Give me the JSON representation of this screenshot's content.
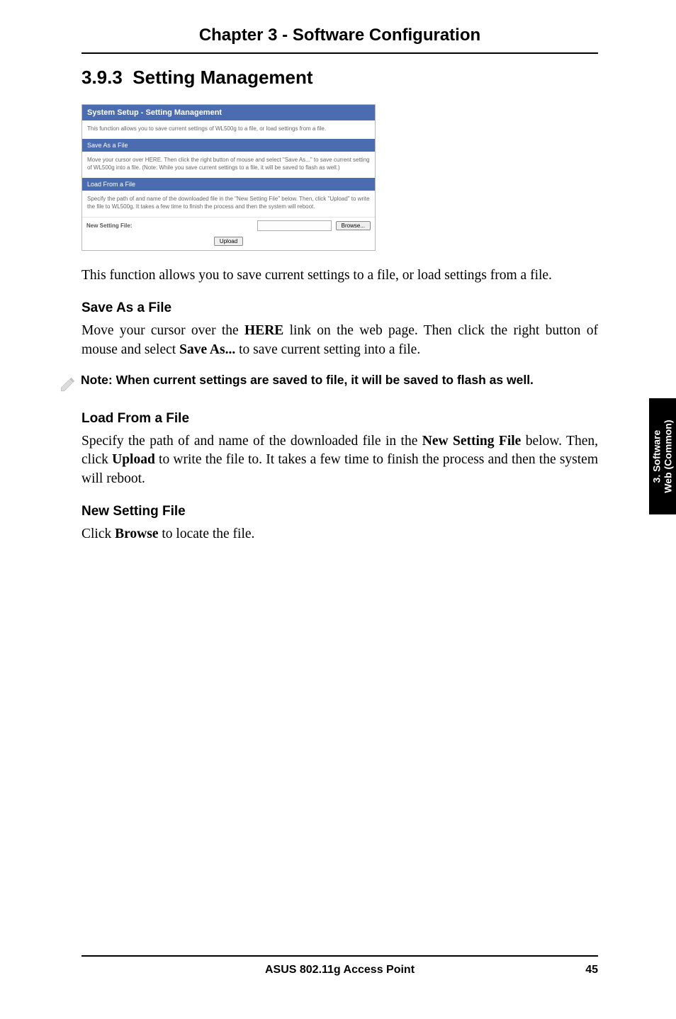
{
  "chapter": {
    "title": "Chapter 3 - Software Configuration"
  },
  "section": {
    "number": "3.9.3",
    "title": "Setting Management"
  },
  "screenshot": {
    "title": "System Setup - Setting Management",
    "intro": "This function allows you to save current settings of WL500g to a file, or load settings from a file.",
    "save_hdr": "Save As a File",
    "save_desc": "Move your cursor over HERE. Then click the right button of mouse and select \"Save As...\" to save current setting of WL500g into a file. (Note: While you save current settings to a file, it will be saved to flash as well.)",
    "load_hdr": "Load From a File",
    "load_desc": "Specify the path of and name of the downloaded file in the \"New Setting File\" below. Then, click \"Upload\" to write the file to WL500g. It takes a few time to finish the process and then the system will reboot.",
    "row_label": "New Setting File:",
    "browse_btn": "Browse...",
    "upload_btn": "Upload"
  },
  "body": {
    "intro": "This function allows you to save current settings to a file, or load settings from a file.",
    "save_heading": "Save As a File",
    "save_t1": "Move your cursor over the ",
    "save_here": "HERE",
    "save_t2": " link on the web page. Then click the right button of mouse and select ",
    "save_saveas": "Save As...",
    "save_t3": " to save current setting into a file.",
    "note": "Note: When current settings are saved to file, it will be saved to flash as well.",
    "load_heading": "Load From a File",
    "load_t1": "Specify the path of and name of the downloaded file in the ",
    "load_nsf": "New Setting File",
    "load_t2": " below. Then, click ",
    "load_upload": "Upload",
    "load_t3": " to write the file to. It takes a few time to finish the process and then the system will reboot.",
    "nsf_heading": "New Setting File",
    "nsf_t1": "Click ",
    "nsf_browse": "Browse",
    "nsf_t2": " to locate the file."
  },
  "sidetab": {
    "line1": "3. Software",
    "line2": "Web (Common)"
  },
  "footer": {
    "product": "ASUS 802.11g Access Point",
    "page": "45"
  }
}
